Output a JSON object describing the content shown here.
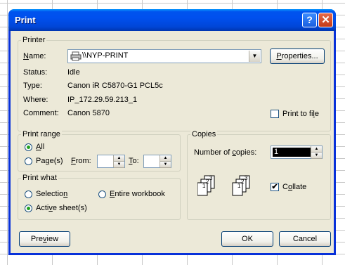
{
  "window": {
    "title": "Print"
  },
  "titlebar_buttons": {
    "help": "?",
    "close": "✕"
  },
  "printer": {
    "group_label": "Printer",
    "name_label": "Name:",
    "name_value": "\\\\NYP-PRINT",
    "properties_button": "Properties...",
    "status_label": "Status:",
    "status_value": "Idle",
    "type_label": "Type:",
    "type_value": "Canon iR C5870-G1 PCL5c",
    "where_label": "Where:",
    "where_value": "IP_172.29.59.213_1",
    "comment_label": "Comment:",
    "comment_value": "Canon 5870",
    "print_to_file_label": "Print to file",
    "print_to_file_checked": false
  },
  "print_range": {
    "group_label": "Print range",
    "all_label": "All",
    "pages_label": "Page(s)",
    "from_label": "From:",
    "to_label": "To:",
    "from_value": "",
    "to_value": "",
    "selected": "all"
  },
  "print_what": {
    "group_label": "Print what",
    "selection_label": "Selection",
    "entire_workbook_label": "Entire workbook",
    "active_sheets_label": "Active sheet(s)",
    "selected": "active_sheets"
  },
  "copies": {
    "group_label": "Copies",
    "number_label": "Number of copies:",
    "number_value": "1",
    "collate_label": "Collate",
    "collate_checked": true,
    "icon_pages": [
      "1",
      "2",
      "3"
    ]
  },
  "buttons": {
    "preview": "Preview",
    "ok": "OK",
    "cancel": "Cancel"
  },
  "icons": {
    "printer_icon": "printer-icon",
    "dropdown_arrow": "▼",
    "spin_up": "▲",
    "spin_down": "▼",
    "checkmark": "✔"
  }
}
